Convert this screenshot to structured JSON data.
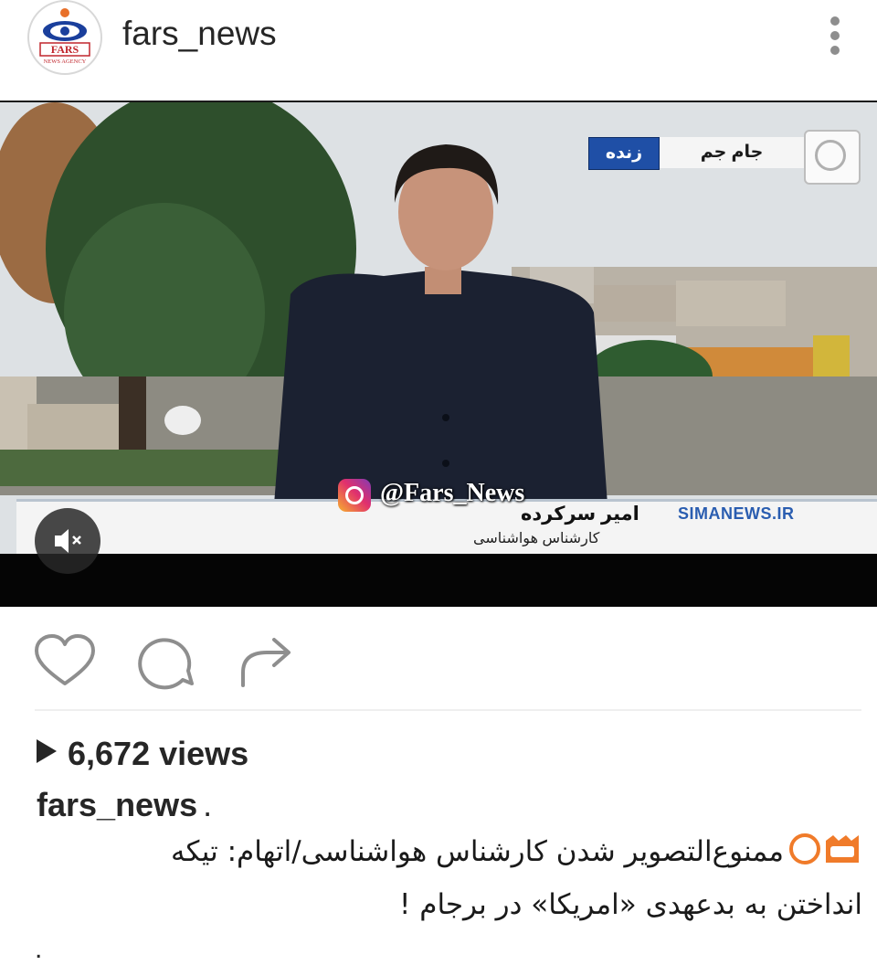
{
  "header": {
    "username": "fars_news",
    "avatar_icon": "fars-news-logo",
    "more_icon": "kebab-menu-icon",
    "avatar_text": {
      "line1": "FARS",
      "line2": "NEWS AGENCY"
    }
  },
  "video": {
    "live_label": "زنده",
    "channel_label": "جام جم",
    "watermark": "@Fars_News",
    "anchor_name": "امیر سرکرده",
    "anchor_title": "کارشناس هواشناسی",
    "website": "SIMANEWS.IR",
    "mute_icon": "speaker-muted-icon",
    "colors": {
      "live_badge": "#1f4fa6",
      "website": "#2a5db0"
    }
  },
  "actions": {
    "like_icon": "heart-icon",
    "comment_icon": "comment-bubble-icon",
    "share_icon": "share-arrow-icon"
  },
  "stats": {
    "views": "6,672 views"
  },
  "caption": {
    "username": "fars_news",
    "username_suffix": ".",
    "text": "ممنوع‌التصویر شدن کارشناس هواشناسی/اتهام: تیکه انداختن به بدعهدی «امریکا» در برجام !",
    "trailing": "."
  }
}
